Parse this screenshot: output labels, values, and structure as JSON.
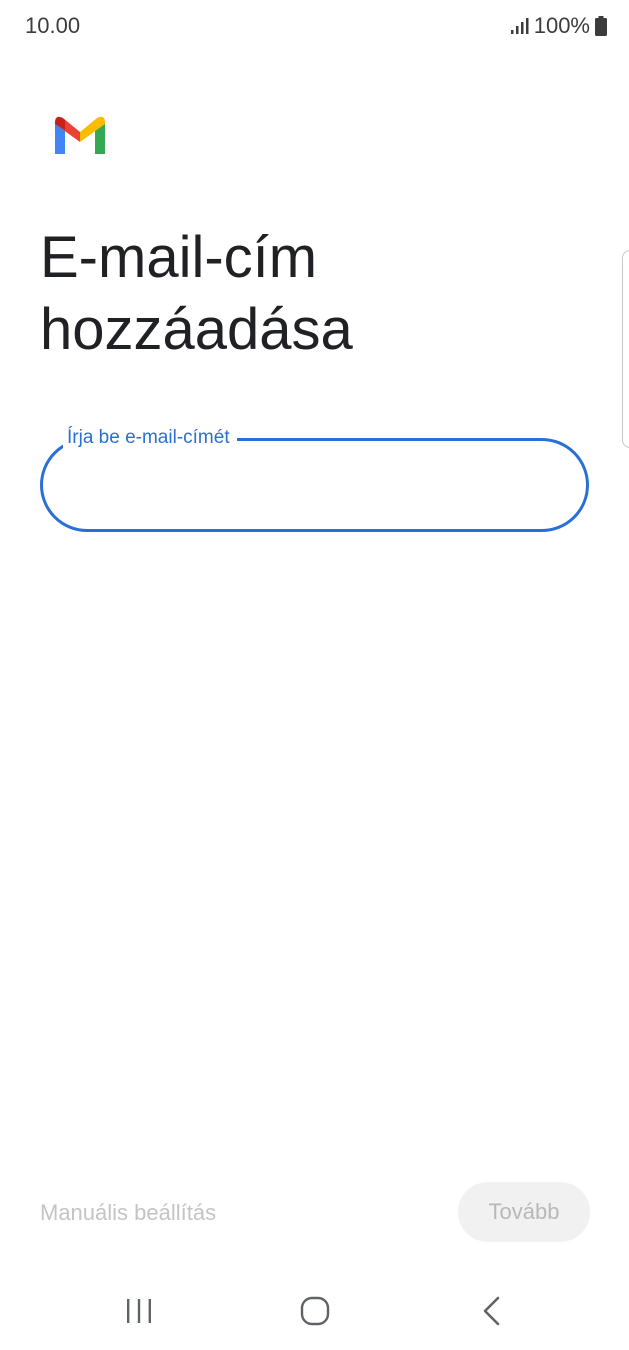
{
  "status_bar": {
    "time": "10.00",
    "battery": "100%",
    "icons": [
      "signal-icon",
      "battery-icon"
    ]
  },
  "header": {
    "logo": "gmail-logo",
    "title_line1": "E-mail-cím",
    "title_line2": "hozzáadása"
  },
  "form": {
    "email_label": "Írja be e-mail-címét",
    "email_value": ""
  },
  "footer": {
    "manual_setup_label": "Manuális beállítás",
    "next_label": "Tovább"
  },
  "nav": {
    "icons": [
      "recents-icon",
      "home-icon",
      "back-icon"
    ]
  },
  "colors": {
    "accent": "#2a6fd6",
    "disabled_text": "#c4c4c4",
    "disabled_button_bg": "#f1f1f1"
  }
}
